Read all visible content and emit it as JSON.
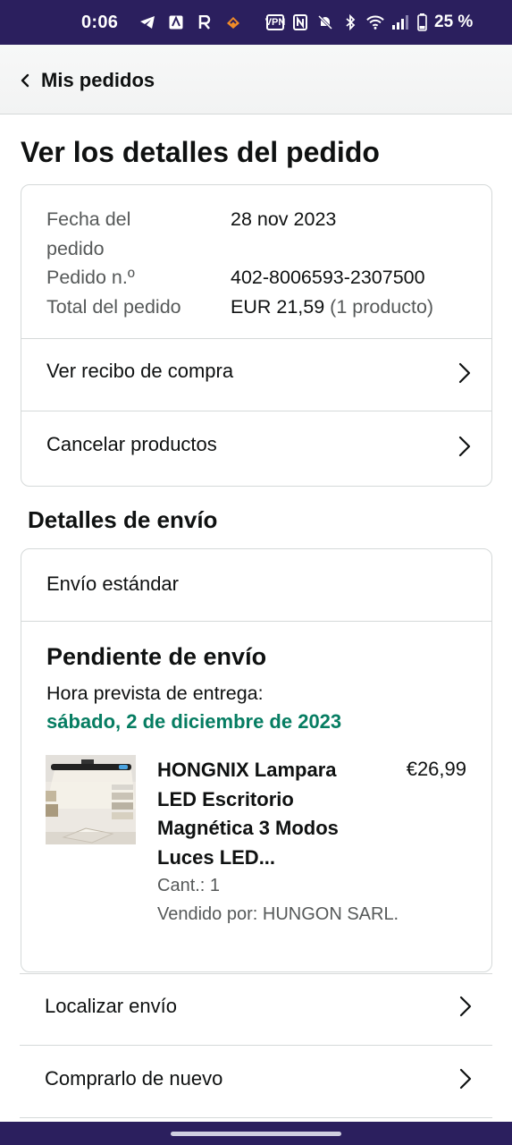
{
  "status_bar": {
    "time": "0:06",
    "vpn_label": "VPN",
    "battery": "25 %"
  },
  "nav": {
    "back_label": "Mis pedidos"
  },
  "page_title": "Ver los detalles del pedido",
  "summary": {
    "date_label_line1": "Fecha del",
    "date_label_line2": "pedido",
    "date_value": "28 nov 2023",
    "order_number_label": "Pedido n.º",
    "order_number_value": "402-8006593-2307500",
    "total_label": "Total del pedido",
    "total_value": "EUR 21,59",
    "total_count": "(1 producto)"
  },
  "actions": {
    "receipt": "Ver recibo de compra",
    "cancel": "Cancelar productos"
  },
  "shipping": {
    "section_title": "Detalles de envío",
    "method": "Envío estándar",
    "status": "Pendiente de envío",
    "eta_label": "Hora prevista de entrega:",
    "eta_date": "sábado, 2 de diciembre de 2023",
    "item": {
      "title": "HONGNIX Lampara LED Escritorio Magnética 3 Modos Luces LED...",
      "price": "€26,99",
      "qty": "Cant.: 1",
      "seller": "Vendido por: HUNGON SARL."
    }
  },
  "bottom_actions": {
    "track": "Localizar envío",
    "buy_again": "Comprarlo de nuevo"
  },
  "colors": {
    "status_bar": "#2b1f5e",
    "eta_green": "#067d62",
    "border": "#d5d9d9"
  }
}
